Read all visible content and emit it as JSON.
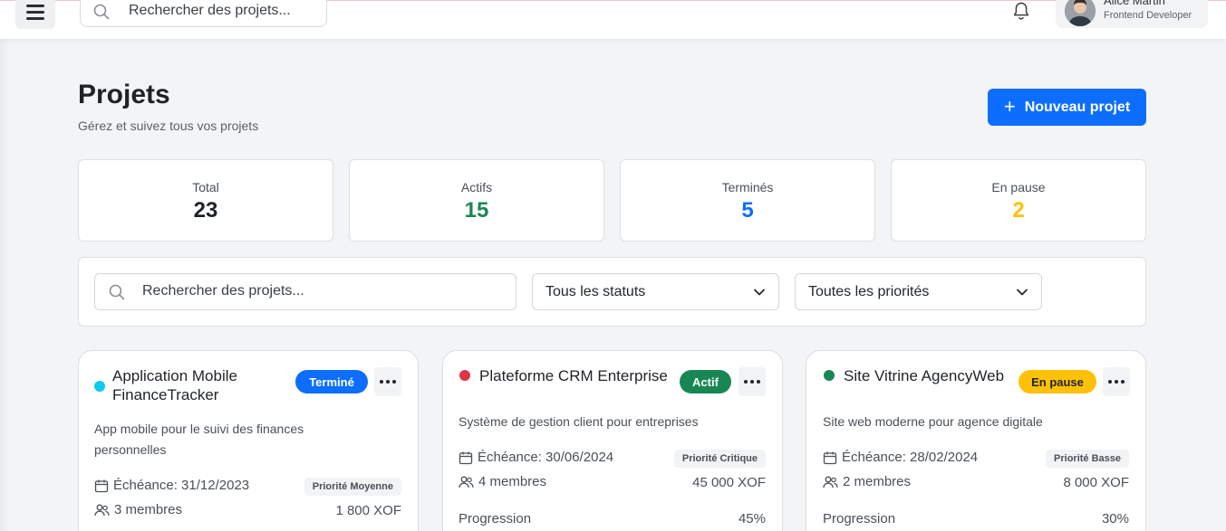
{
  "topbar": {
    "search_placeholder": "Rechercher des projets...",
    "user": {
      "name": "Alice Martin",
      "role": "Frontend Developer"
    }
  },
  "header": {
    "title": "Projets",
    "subtitle": "Gérez et suivez tous vos projets",
    "new_button": "Nouveau projet"
  },
  "stats": [
    {
      "label": "Total",
      "value": "23",
      "color": "#1f2328"
    },
    {
      "label": "Actifs",
      "value": "15",
      "color": "#198754"
    },
    {
      "label": "Terminés",
      "value": "5",
      "color": "#0d6efd"
    },
    {
      "label": "En pause",
      "value": "2",
      "color": "#ffc107"
    }
  ],
  "filters": {
    "search_placeholder": "Rechercher des projets...",
    "status_selected": "Tous les statuts",
    "priority_selected": "Toutes les priorités"
  },
  "projects": [
    {
      "title": "Application Mobile FinanceTracker",
      "dot_color": "#0dcaf0",
      "status": "Terminé",
      "status_bg": "#0d6efd",
      "status_fg": "#ffffff",
      "description": "App mobile pour le suivi des finances personnelles",
      "deadline": "Échéance: 31/12/2023",
      "priority": "Priorité Moyenne",
      "members": "3 membres",
      "budget": "1 800 XOF"
    },
    {
      "title": "Plateforme CRM Enterprise",
      "dot_color": "#dc3545",
      "status": "Actif",
      "status_bg": "#198754",
      "status_fg": "#ffffff",
      "description": "Système de gestion client pour entreprises",
      "deadline": "Échéance: 30/06/2024",
      "priority": "Priorité Critique",
      "members": "4 membres",
      "budget": "45 000 XOF",
      "progress_label": "Progression",
      "progress": "45%"
    },
    {
      "title": "Site Vitrine AgencyWeb",
      "dot_color": "#198754",
      "status": "En pause",
      "status_bg": "#ffc107",
      "status_fg": "#1f2328",
      "description": "Site web moderne pour agence digitale",
      "deadline": "Échéance: 28/02/2024",
      "priority": "Priorité Basse",
      "members": "2 membres",
      "budget": "8 000 XOF",
      "progress_label": "Progression",
      "progress": "30%"
    }
  ]
}
